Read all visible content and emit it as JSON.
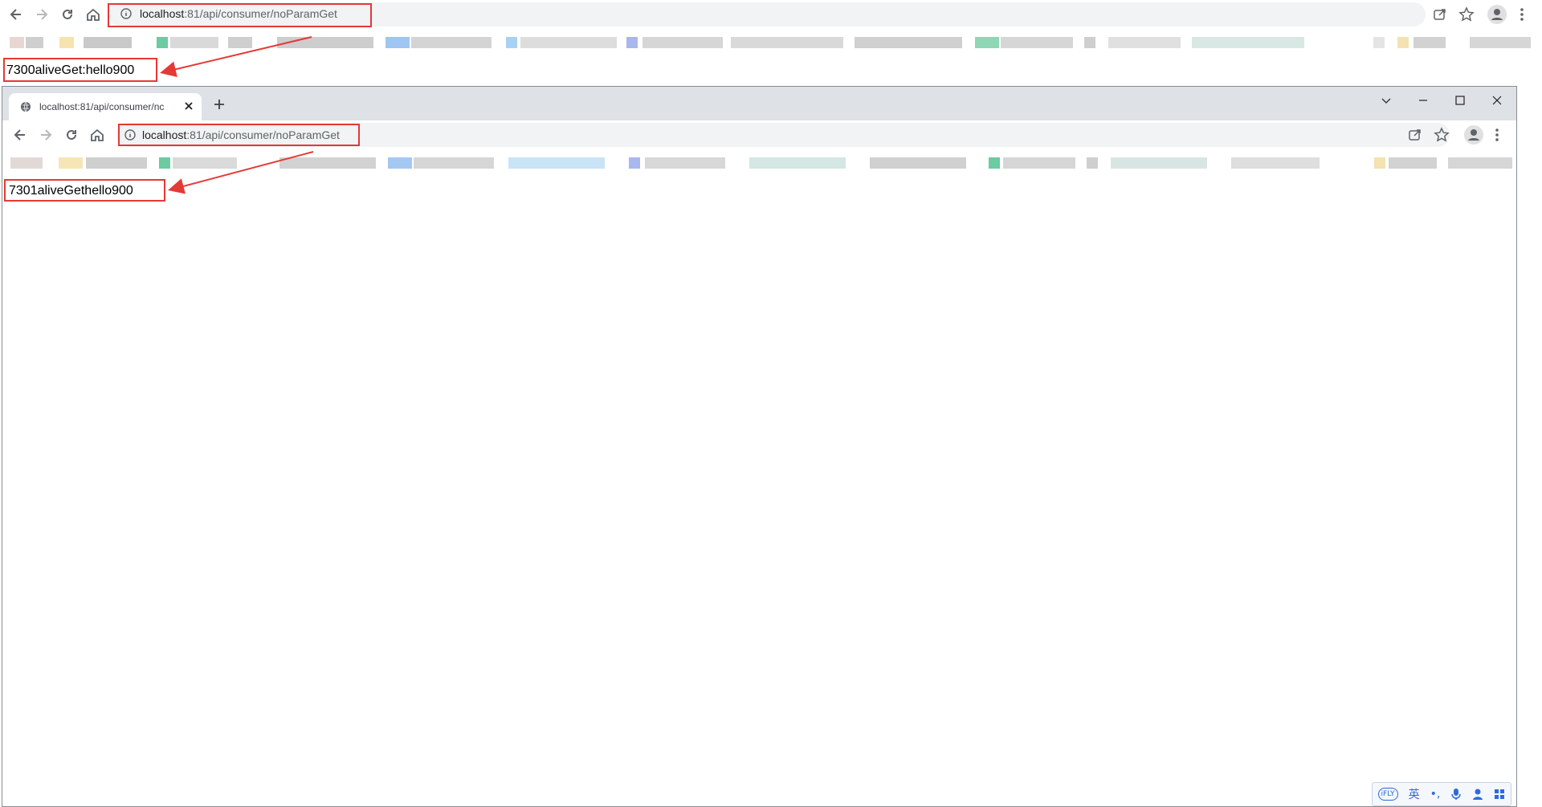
{
  "outer_browser": {
    "url_host": "localhost",
    "url_path": ":81/api/consumer/noParamGet",
    "page_text": "7300aliveGet:hello900"
  },
  "inner_browser": {
    "tab_title": "localhost:81/api/consumer/nc",
    "url_host": "localhost",
    "url_path": ":81/api/consumer/noParamGet",
    "page_text": "7301aliveGethello900"
  },
  "ime_toolbar": {
    "logo": "iFLY",
    "lang": "英",
    "punct": "•,",
    "icons": [
      "mic-icon",
      "user-icon",
      "grid-icon"
    ]
  },
  "colors": {
    "annotation_red": "#e53935",
    "tabstrip": "#dee1e6",
    "omnibox": "#f1f3f4"
  }
}
